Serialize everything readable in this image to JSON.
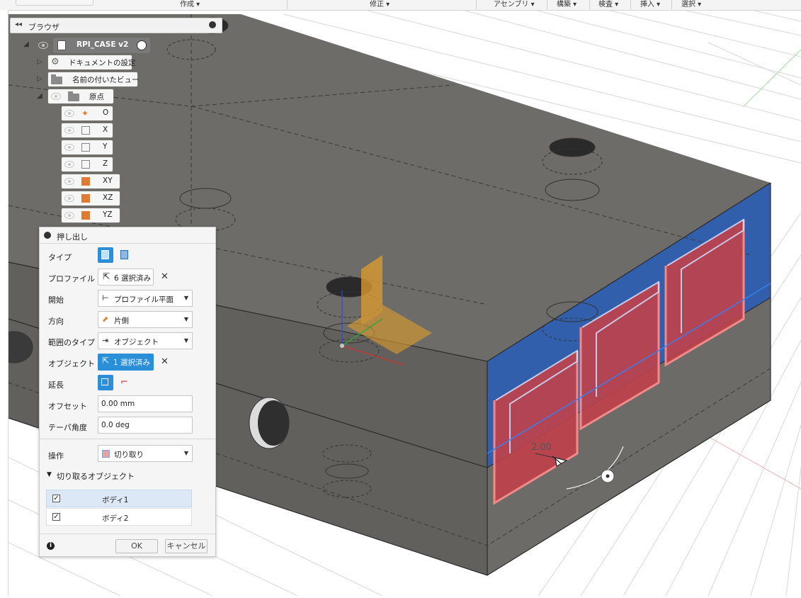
{
  "menubar": {
    "items": [
      {
        "label": "作成 ▾"
      },
      {
        "label": "修正 ▾"
      },
      {
        "label": "アセンブリ ▾"
      },
      {
        "label": "構築 ▾"
      },
      {
        "label": "検査 ▾"
      },
      {
        "label": "挿入 ▾"
      },
      {
        "label": "選択 ▾"
      }
    ]
  },
  "browser": {
    "title": "ブラウザ",
    "root": "RPI_CASE v2",
    "items": [
      "ドキュメントの設定",
      "名前の付いたビュー",
      "原点"
    ],
    "origin_items": [
      "O",
      "X",
      "Y",
      "Z",
      "XY",
      "XZ",
      "YZ"
    ]
  },
  "extrude": {
    "title": "押し出し",
    "type_label": "タイプ",
    "profile_label": "プロファイル",
    "profile_value": "6 選択済み",
    "start_label": "開始",
    "start_value": "プロファイル平面",
    "direction_label": "方向",
    "direction_value": "片側",
    "extent_label": "範囲のタイプ",
    "extent_value": "オブジェクト",
    "object_label": "オブジェクト",
    "object_value": "1 選択済み",
    "extend_label": "延長",
    "offset_label": "オフセット",
    "offset_value": "0.00 mm",
    "taper_label": "テーパ角度",
    "taper_value": "0.0 deg",
    "operation_label": "操作",
    "operation_value": "切り取り",
    "cut_section": "切り取るオブジェクト",
    "bodies": [
      {
        "name": "ボディ1",
        "checked": true
      },
      {
        "name": "ボディ2",
        "checked": true
      }
    ],
    "ok": "OK",
    "cancel": "キャンセル"
  },
  "viewport": {
    "dimension": "2.00"
  },
  "colors": {
    "accent": "#2a8ed8",
    "body": "#6f6d69",
    "selected_face": "#2f5fb0",
    "profile": "#c0414a"
  }
}
